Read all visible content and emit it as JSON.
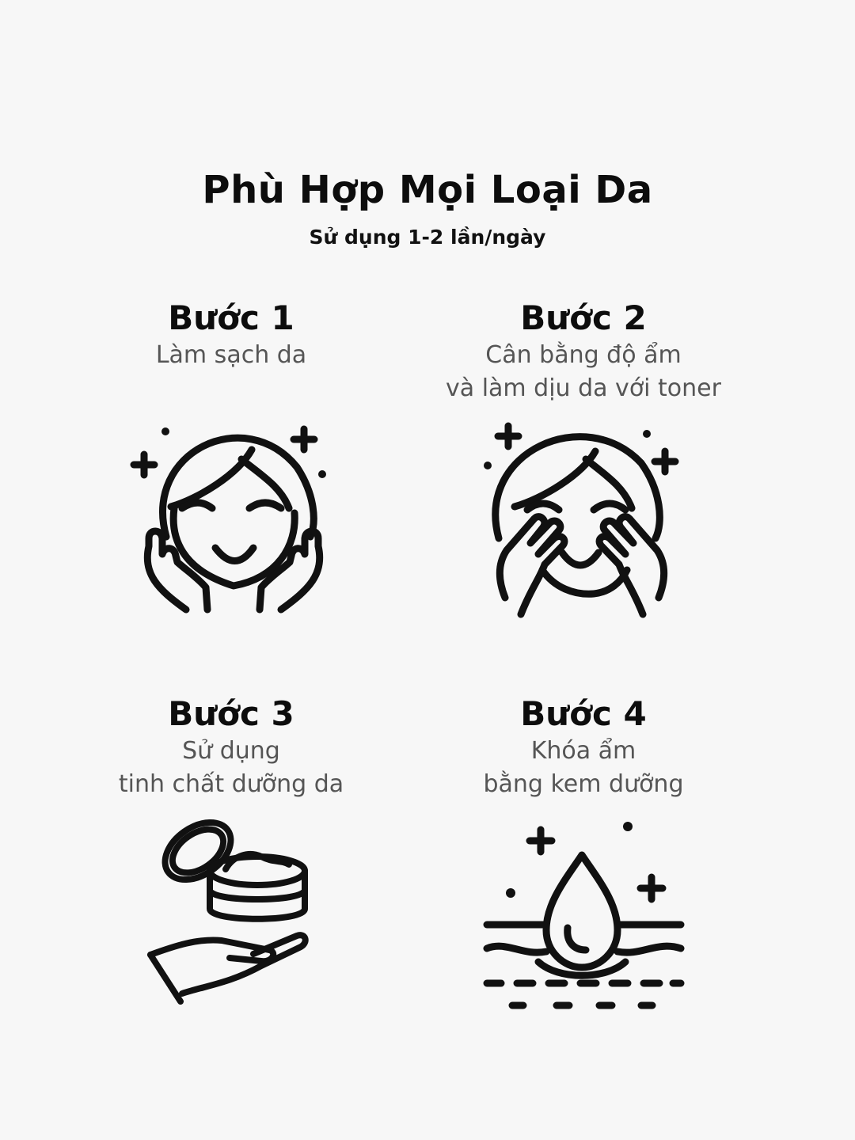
{
  "header": {
    "title": "Phù Hợp Mọi Loại Da",
    "subtitle": "Sử dụng 1-2 lần/ngày"
  },
  "steps": [
    {
      "title": "Bước 1",
      "desc_line1": "Làm sạch da",
      "desc_line2": "",
      "icon": "face-washing-icon"
    },
    {
      "title": "Bước 2",
      "desc_line1": "Cân bằng độ ẩm",
      "desc_line2": "và làm dịu da với toner",
      "icon": "face-patting-icon"
    },
    {
      "title": "Bước 3",
      "desc_line1": "Sử dụng",
      "desc_line2": "tinh chất dưỡng da",
      "icon": "cream-jar-hand-icon"
    },
    {
      "title": "Bước 4",
      "desc_line1": "Khóa ẩm",
      "desc_line2": "bằng kem dưỡng",
      "icon": "water-drop-skin-icon"
    }
  ],
  "colors": {
    "background": "#f7f7f7",
    "ink": "#111111",
    "muted": "#555555"
  }
}
